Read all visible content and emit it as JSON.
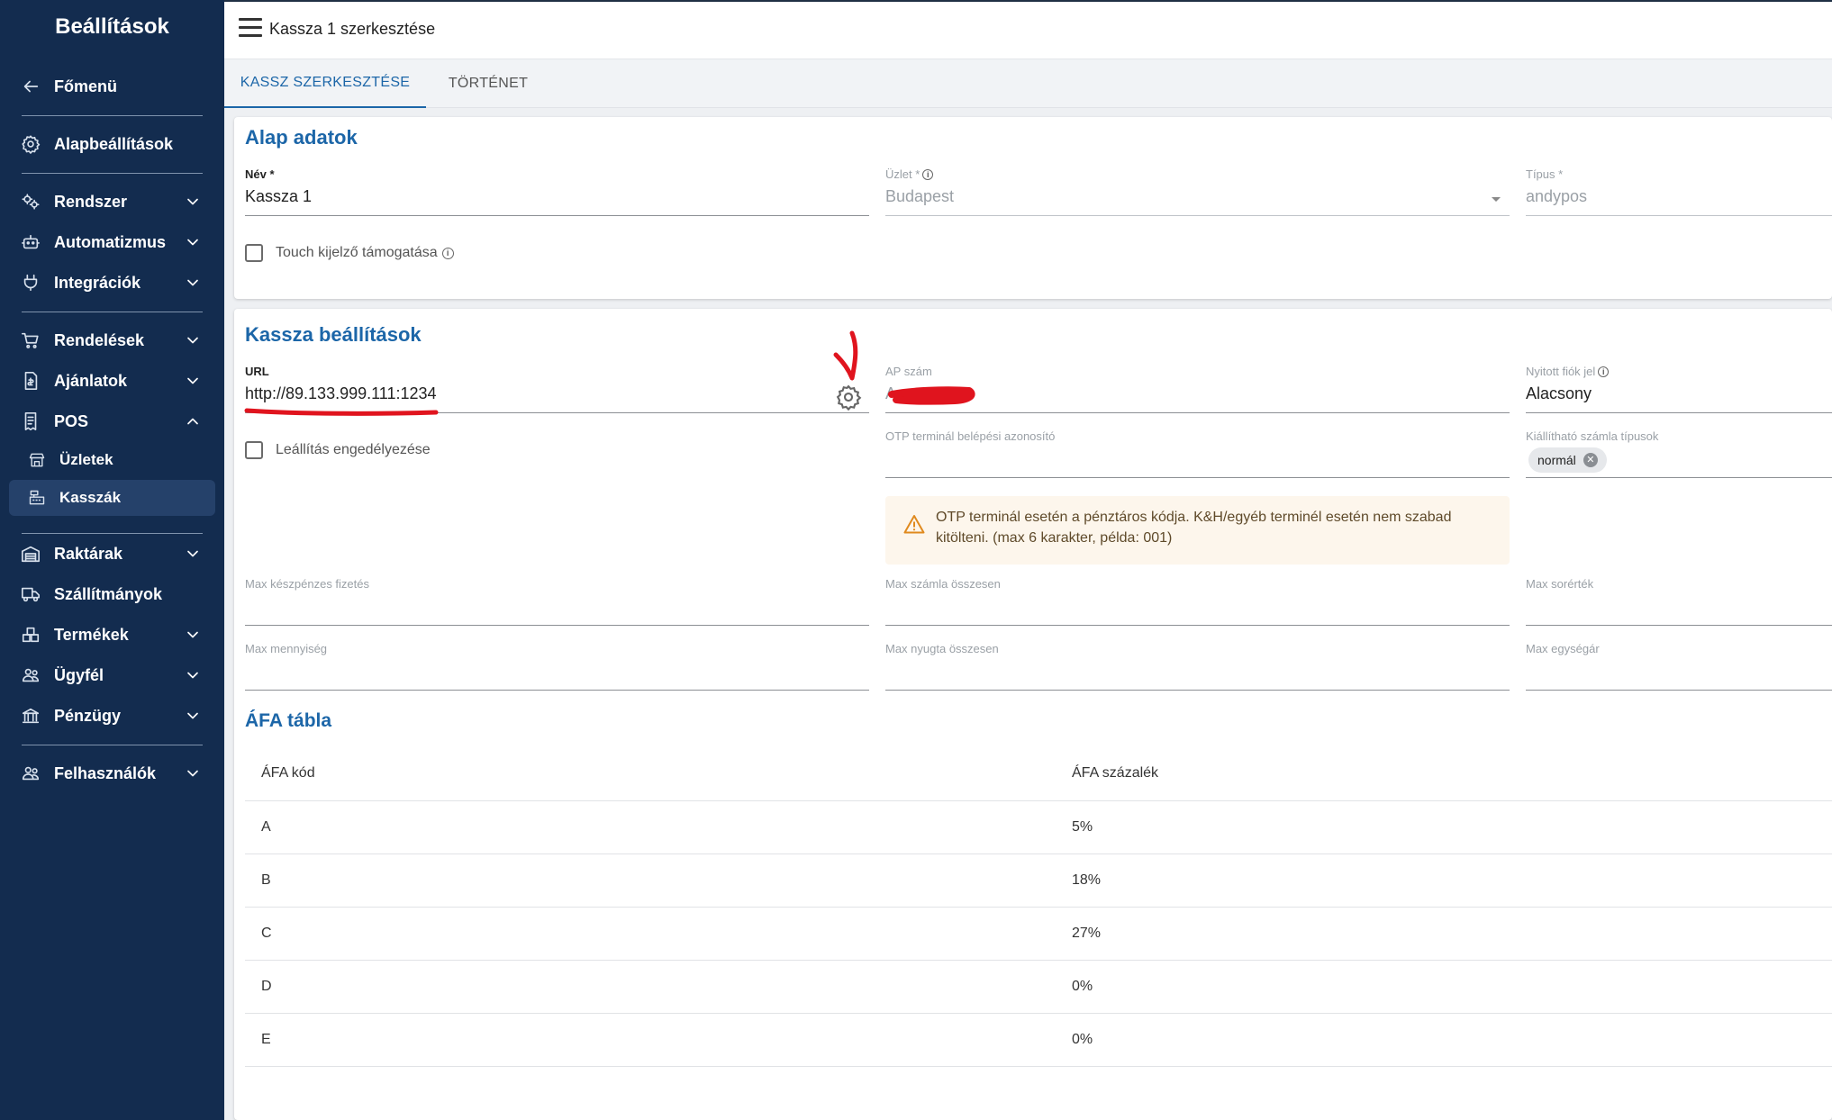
{
  "sidebar": {
    "title": "Beállítások",
    "back_label": "Főmenü",
    "items": [
      {
        "label": "Alapbeállítások"
      },
      {
        "label": "Rendszer"
      },
      {
        "label": "Automatizmus"
      },
      {
        "label": "Integrációk"
      },
      {
        "label": "Rendelések"
      },
      {
        "label": "Ajánlatok"
      },
      {
        "label": "POS"
      },
      {
        "label": "Üzletek"
      },
      {
        "label": "Kasszák"
      },
      {
        "label": "Raktárak"
      },
      {
        "label": "Szállítmányok"
      },
      {
        "label": "Termékek"
      },
      {
        "label": "Ügyfél"
      },
      {
        "label": "Pénzügy"
      },
      {
        "label": "Felhasználók"
      }
    ]
  },
  "topbar": {
    "title": "Kassza 1 szerkesztése"
  },
  "tabs": [
    {
      "label": "KASSZ SZERKESZTÉSE",
      "active": true
    },
    {
      "label": "TÖRTÉNET",
      "active": false
    }
  ],
  "basic": {
    "title": "Alap adatok",
    "name_label": "Név *",
    "name_value": "Kassza 1",
    "shop_label": "Üzlet *",
    "shop_value": "Budapest",
    "type_label": "Típus *",
    "type_value": "andypos",
    "touch_label": "Touch kijelző támogatása"
  },
  "register": {
    "title": "Kassza beállítások",
    "url_label": "URL",
    "url_value": "http://89.133.999.111:1234",
    "ap_label": "AP szám",
    "ap_value": "A",
    "drawer_label": "Nyitott fiók jel",
    "drawer_value": "Alacsony",
    "shutdown_label": "Leállítás engedélyezése",
    "otp_label": "OTP terminál belépési azonosító",
    "otp_value": "",
    "invoice_types_label": "Kiállítható számla típusok",
    "invoice_chip": "normál",
    "alert_text": "OTP terminál esetén a pénztáros kódja. K&H/egyéb terminél esetén nem szabad kitölteni. (max 6 karakter, példa: 001)",
    "max_cash_label": "Max készpénzes fizetés",
    "max_invoice_total_label": "Max számla összesen",
    "max_row_value_label": "Max sorérték",
    "max_quantity_label": "Max mennyiség",
    "max_receipt_total_label": "Max nyugta összesen",
    "max_unit_price_label": "Max egységár"
  },
  "vat": {
    "title": "ÁFA tábla",
    "col_code": "ÁFA kód",
    "col_percent": "ÁFA százalék",
    "rows": [
      {
        "code": "A",
        "percent": "5%"
      },
      {
        "code": "B",
        "percent": "18%"
      },
      {
        "code": "C",
        "percent": "27%"
      },
      {
        "code": "D",
        "percent": "0%"
      },
      {
        "code": "E",
        "percent": "0%"
      }
    ]
  },
  "colors": {
    "sidebar_bg": "#132c4f",
    "accent": "#1c66a8",
    "annotation_red": "#e0141e"
  }
}
